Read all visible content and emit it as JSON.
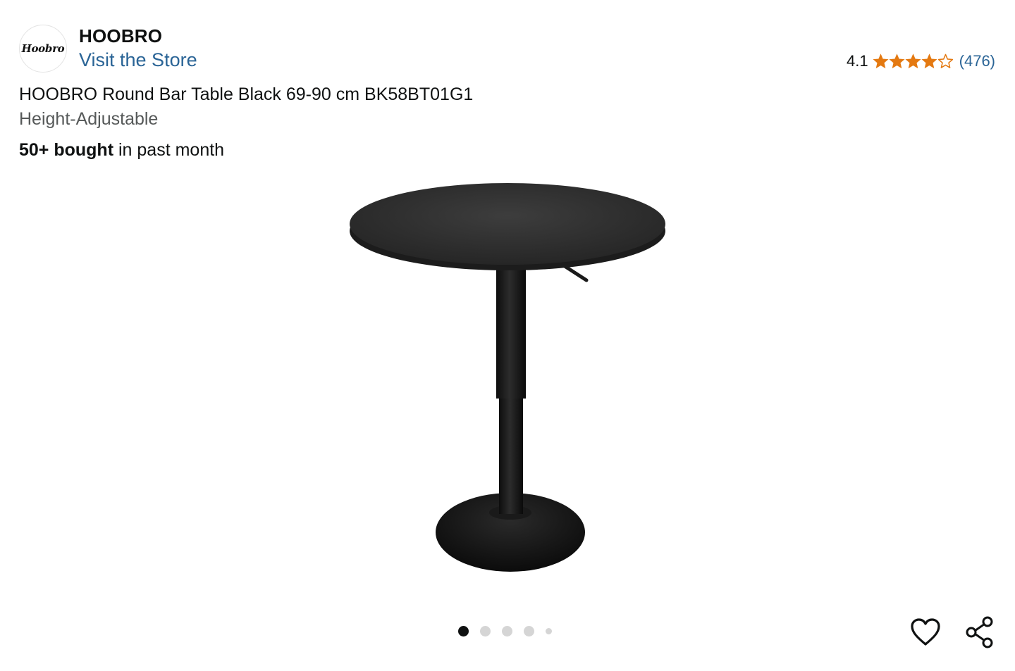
{
  "store": {
    "logo_text": "Hoobro",
    "brand_name": "HOOBRO",
    "visit_label": "Visit the Store"
  },
  "rating": {
    "score": "4.1",
    "stars_value": 4.1,
    "stars_max": 5,
    "count": "(476)",
    "star_color": "#e47911"
  },
  "product": {
    "title": "HOOBRO Round Bar Table Black 69-90 cm BK58BT01G1",
    "subtitle": "Height-Adjustable",
    "bought_bold": "50+ bought",
    "bought_rest": " in past month"
  },
  "gallery": {
    "image_count": 5,
    "active_index": 0
  },
  "icons": {
    "favorite": "heart-icon",
    "share": "share-icon"
  },
  "colors": {
    "link": "#2a6496",
    "text": "#0f1111",
    "muted": "#565959",
    "star": "#e47911"
  }
}
